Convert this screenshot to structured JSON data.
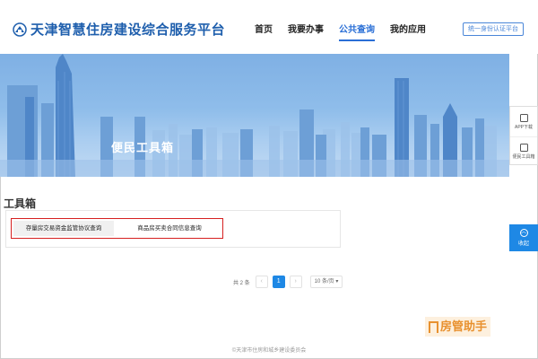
{
  "header": {
    "site_title": "天津智慧住房建设综合服务平台",
    "nav": [
      {
        "label": "首页",
        "active": false
      },
      {
        "label": "我要办事",
        "active": false
      },
      {
        "label": "公共查询",
        "active": true
      },
      {
        "label": "我的应用",
        "active": false
      }
    ],
    "auth_button": "统一身份认证平台"
  },
  "banner": {
    "title": "便民工具箱"
  },
  "side_tools": {
    "items": [
      {
        "label": "APP下载",
        "icon": "mobile-icon"
      },
      {
        "label": "便民工具箱",
        "icon": "toolbox-icon"
      }
    ],
    "collapse_label": "收起"
  },
  "toolbox": {
    "title": "工具箱",
    "items": [
      {
        "label": "存量房交易资金监管协议查询"
      },
      {
        "label": "商品房买卖合同信息查询"
      }
    ]
  },
  "pagination": {
    "total": "共 2 条",
    "prev": "‹",
    "current_page": "1",
    "next": "›",
    "page_size": "10 条/页"
  },
  "watermark": {
    "text": "房管助手"
  },
  "footer": {
    "text": "©天津市住房和城乡建设委员会"
  },
  "colors": {
    "brand": "#1f5fad",
    "accent": "#1e88e5",
    "highlight_border": "#d62020",
    "watermark": "#e8912f"
  }
}
